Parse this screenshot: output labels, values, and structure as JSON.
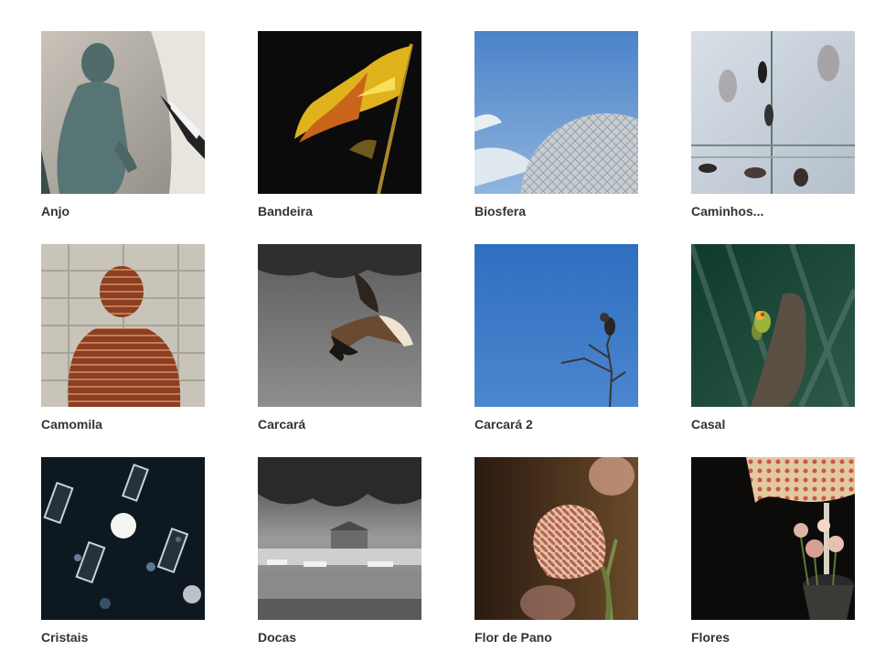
{
  "gallery": {
    "items": [
      {
        "title": "Anjo"
      },
      {
        "title": "Bandeira"
      },
      {
        "title": "Biosfera"
      },
      {
        "title": "Caminhos..."
      },
      {
        "title": "Camomila"
      },
      {
        "title": "Carcará"
      },
      {
        "title": "Carcará 2"
      },
      {
        "title": "Casal"
      },
      {
        "title": "Cristais"
      },
      {
        "title": "Docas"
      },
      {
        "title": "Flor de Pano"
      },
      {
        "title": "Flores"
      }
    ]
  }
}
